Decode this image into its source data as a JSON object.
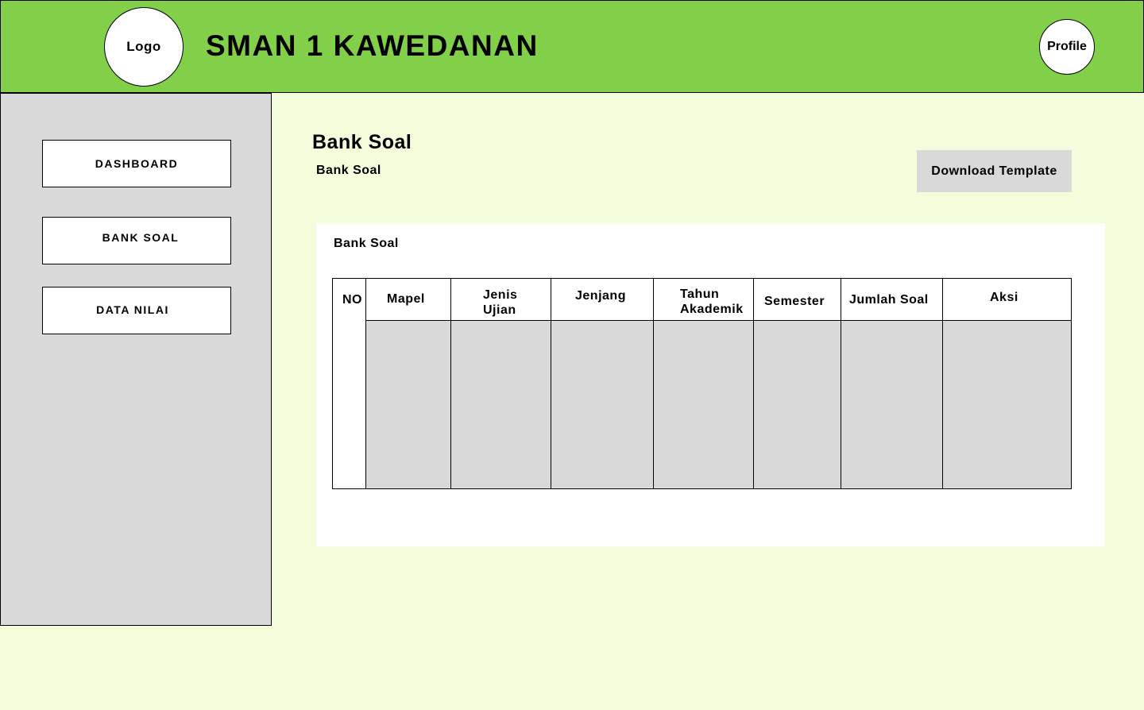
{
  "header": {
    "logo_label": "Logo",
    "school_name": "SMAN 1 KAWEDANAN",
    "profile_label": "Profile"
  },
  "sidebar": {
    "items": [
      {
        "label": "DASHBOARD"
      },
      {
        "label": "BANK SOAL"
      },
      {
        "label": "DATA NILAI"
      }
    ]
  },
  "main": {
    "title": "Bank Soal",
    "breadcrumb": "Bank Soal",
    "download_button": "Download Template",
    "card_title": "Bank Soal",
    "table": {
      "columns": [
        "NO",
        "Mapel",
        "Jenis\nUjian",
        "Jenjang",
        "Tahun\nAkademik",
        "Semester",
        "Jumlah Soal",
        "Aksi"
      ],
      "rows": []
    }
  },
  "colors": {
    "header_bg": "#82cf4a",
    "page_bg": "#f3fddb",
    "sidebar_bg": "#d9d9d9",
    "button_bg": "#d9d9d9"
  }
}
